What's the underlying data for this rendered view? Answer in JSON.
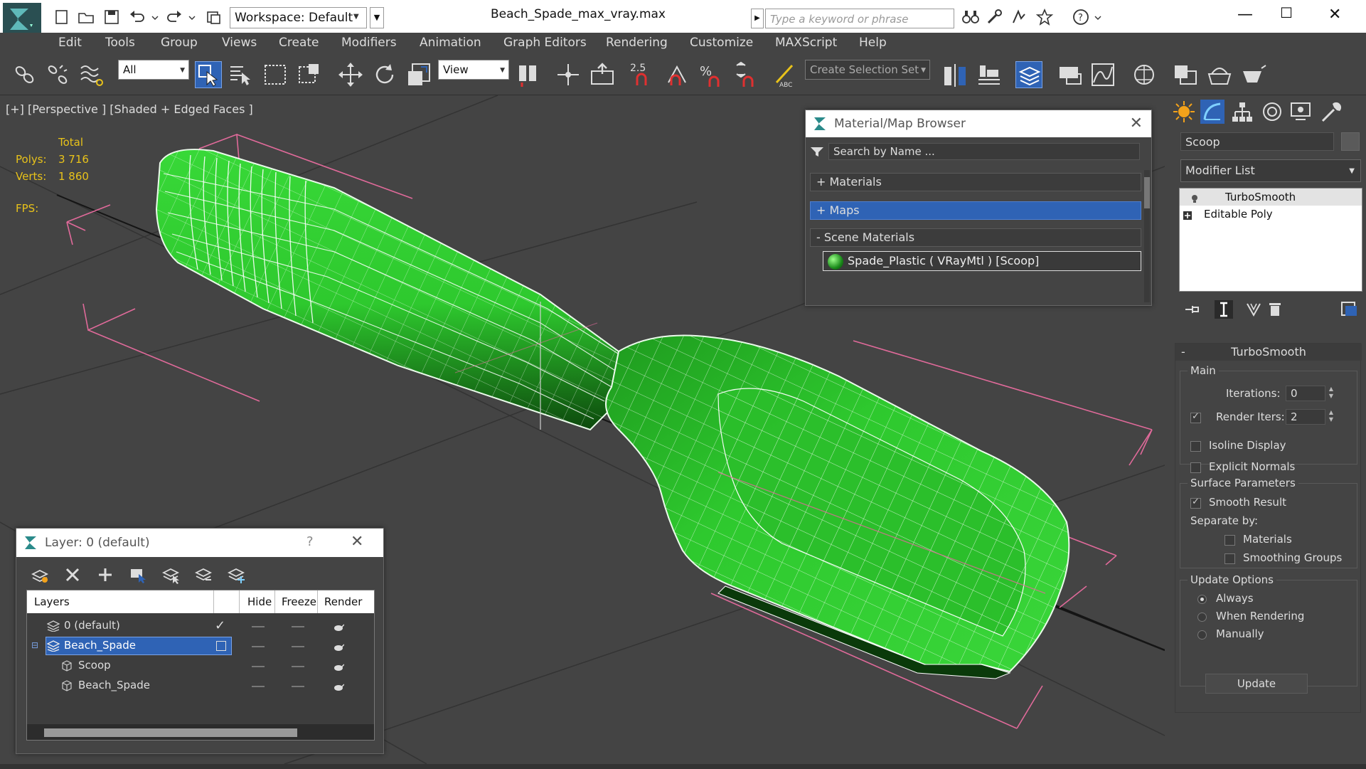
{
  "title_bar": {
    "workspace_label": "Workspace: Default",
    "document_title": "Beach_Spade_max_vray.max",
    "search_placeholder": "Type a keyword or phrase"
  },
  "menu": [
    "Edit",
    "Tools",
    "Group",
    "Views",
    "Create",
    "Modifiers",
    "Animation",
    "Graph Editors",
    "Rendering",
    "Customize",
    "MAXScript",
    "Help"
  ],
  "toolbar": {
    "selection_filter": "All",
    "reference_coord": "View",
    "snap_value": "2.5",
    "selection_set_placeholder": "Create Selection Set"
  },
  "viewport": {
    "label": "[+] [Perspective ] [Shaded + Edged Faces ]",
    "stats_total": "Total",
    "polys_label": "Polys:",
    "polys_value": "3 716",
    "verts_label": "Verts:",
    "verts_value": "1 860",
    "fps_label": "FPS:"
  },
  "material_browser": {
    "title": "Material/Map Browser",
    "search_placeholder": "Search by Name ...",
    "categories": [
      {
        "label": "+ Materials",
        "selected": false
      },
      {
        "label": "+ Maps",
        "selected": true
      },
      {
        "label": "- Scene Materials",
        "selected": false
      }
    ],
    "scene_material": "Spade_Plastic ( VRayMtl ) [Scoop]"
  },
  "command_panel": {
    "object_name": "Scoop",
    "modifier_list": "Modifier List",
    "stack": [
      "TurboSmooth",
      "Editable Poly"
    ],
    "turbosmooth": {
      "header": "TurboSmooth",
      "main_group": "Main",
      "iterations_label": "Iterations:",
      "iterations_value": "0",
      "render_iters_label": "Render Iters:",
      "render_iters_value": "2",
      "isoline_label": "Isoline Display",
      "explicit_normals_label": "Explicit Normals",
      "surface_group": "Surface Parameters",
      "smooth_result_label": "Smooth Result",
      "separate_by_label": "Separate by:",
      "materials_label": "Materials",
      "smoothing_groups_label": "Smoothing Groups",
      "update_group": "Update Options",
      "always_label": "Always",
      "when_rendering_label": "When Rendering",
      "manually_label": "Manually",
      "update_button": "Update"
    }
  },
  "layer_explorer": {
    "title": "Layer: 0 (default)",
    "help": "?",
    "columns": [
      "Layers",
      "Hide",
      "Freeze",
      "Render"
    ],
    "rows": [
      {
        "name": "0 (default)"
      },
      {
        "name": "Beach_Spade"
      },
      {
        "name": "Scoop"
      },
      {
        "name": "Beach_Spade"
      }
    ]
  },
  "colors": {
    "mesh_green": "#2ec92e",
    "selection_blue": "#2f63b5",
    "stats_yellow": "#e8c21a",
    "bbox_pink": "#e06a9a"
  }
}
